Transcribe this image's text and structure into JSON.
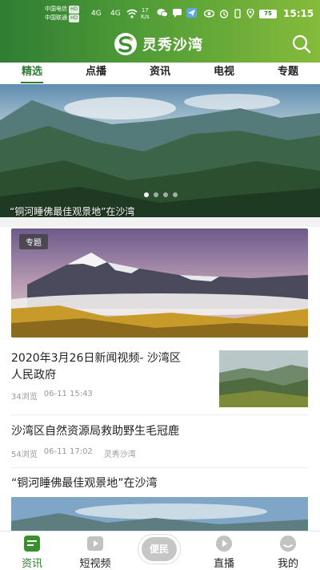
{
  "status_bar": {
    "carrier1": "中国电信",
    "carrier2": "中国联通",
    "hd": "HD",
    "sig1": "4G",
    "sig2": "4G",
    "speed_value": "17",
    "speed_unit": "K/s",
    "battery": "75",
    "time": "15:15"
  },
  "header": {
    "app_name": "灵秀沙湾",
    "icons": [
      "wechat-icon",
      "message-icon",
      "telegram-icon",
      "search-icon"
    ]
  },
  "tabs": [
    {
      "label": "精选",
      "active": true
    },
    {
      "label": "点播",
      "active": false
    },
    {
      "label": "资讯",
      "active": false
    },
    {
      "label": "电视",
      "active": false
    },
    {
      "label": "专题",
      "active": false
    }
  ],
  "banner": {
    "caption": "“铜河睡佛最佳观景地”在沙湾",
    "slide_index": 1,
    "slide_count": 4
  },
  "feature": {
    "tag": "专题"
  },
  "news": [
    {
      "title_line1": "2020年3月26日新闻视频- 沙湾区",
      "title_line2": "人民政府",
      "views": "34浏览",
      "date": "06-11 15:43",
      "source": ""
    },
    {
      "title_line1": "沙湾区自然资源局救助野生毛冠鹿",
      "views": "54浏览",
      "date": "06-11 17:02",
      "source": "灵秀沙湾"
    },
    {
      "title_line1": "“铜河睡佛最佳观景地”在沙湾"
    }
  ],
  "bottom_nav": {
    "items": [
      {
        "label": "资讯",
        "icon": "news-icon",
        "active": true
      },
      {
        "label": "短视频",
        "icon": "video-icon",
        "active": false
      },
      {
        "label": "便民",
        "icon": "service-icon",
        "active": false
      },
      {
        "label": "直播",
        "icon": "live-icon",
        "active": false
      },
      {
        "label": "我的",
        "icon": "profile-icon",
        "active": false
      }
    ]
  },
  "colors": {
    "brand_green": "#2f7d33",
    "header_gradient_end": "#86bb3b"
  }
}
